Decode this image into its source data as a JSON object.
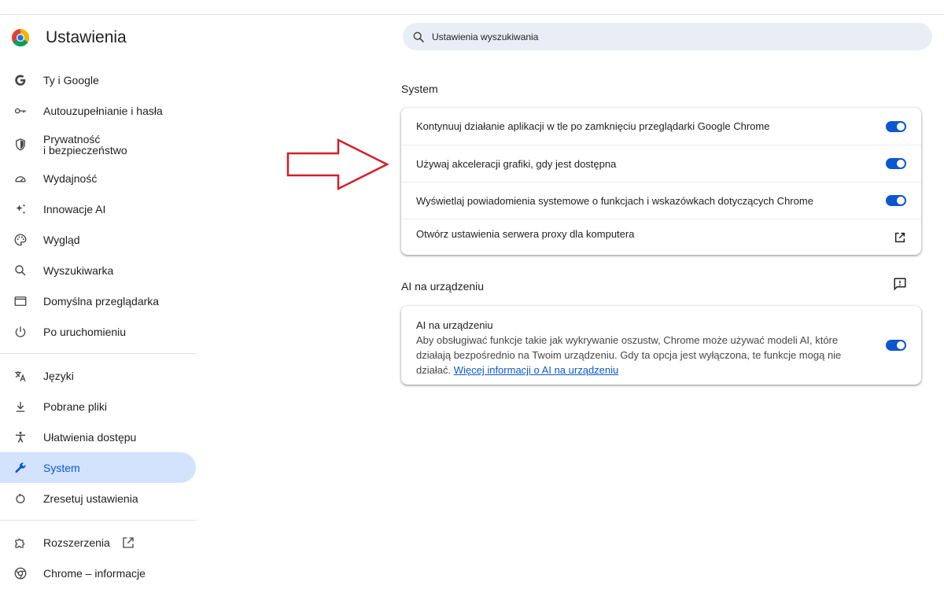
{
  "header": {
    "title": "Ustawienia",
    "search_placeholder": "Ustawienia wyszukiwania"
  },
  "sidebar": {
    "items": [
      {
        "label": "Ty i Google",
        "icon": "google-g-icon"
      },
      {
        "label": "Autouzupełnianie i hasła",
        "icon": "key-icon"
      },
      {
        "label": "Prywatność\ni bezpieczeństwo",
        "icon": "shield-icon"
      },
      {
        "label": "Wydajność",
        "icon": "speedometer-icon"
      },
      {
        "label": "Innowacje AI",
        "icon": "sparkle-icon"
      },
      {
        "label": "Wygląd",
        "icon": "palette-icon"
      },
      {
        "label": "Wyszukiwarka",
        "icon": "search-icon"
      },
      {
        "label": "Domyślna przeglądarka",
        "icon": "browser-window-icon"
      },
      {
        "label": "Po uruchomieniu",
        "icon": "power-icon"
      },
      {
        "label": "Języki",
        "icon": "translate-icon"
      },
      {
        "label": "Pobrane pliki",
        "icon": "download-icon"
      },
      {
        "label": "Ułatwienia dostępu",
        "icon": "accessibility-icon"
      },
      {
        "label": "System",
        "icon": "wrench-icon",
        "active": true
      },
      {
        "label": "Zresetuj ustawienia",
        "icon": "reset-icon"
      },
      {
        "label": "Rozszerzenia",
        "icon": "puzzle-icon"
      },
      {
        "label": "Chrome – informacje",
        "icon": "chrome-icon"
      }
    ]
  },
  "system": {
    "title": "System",
    "rows": [
      {
        "label": "Kontynuuj działanie aplikacji w tle po zamknięciu przeglądarki Google Chrome",
        "enabled": true
      },
      {
        "label": "Używaj akceleracji grafiki, gdy jest dostępna",
        "enabled": true
      },
      {
        "label": "Wyświetlaj powiadomienia systemowe o funkcjach i wskazówkach dotyczących Chrome",
        "enabled": true
      },
      {
        "label": "Otwórz ustawienia serwera proxy dla komputera"
      }
    ]
  },
  "ai_section": {
    "title": "AI na urządzeniu",
    "row_title": "AI na urządzeniu",
    "description": "Aby obsługiwać funkcje takie jak wykrywanie oszustw, Chrome może używać modeli AI, które działają bezpośrednio na Twoim urządzeniu. Gdy ta opcja jest wyłączona, te funkcje mogą nie działać.",
    "link": "Więcej informacji o AI na urządzeniu",
    "enabled": true
  },
  "colors": {
    "accent": "#0b57d0",
    "active_bg": "#d3e3fd",
    "search_bg": "#e9eef6",
    "annotation_arrow": "#d0202a"
  }
}
